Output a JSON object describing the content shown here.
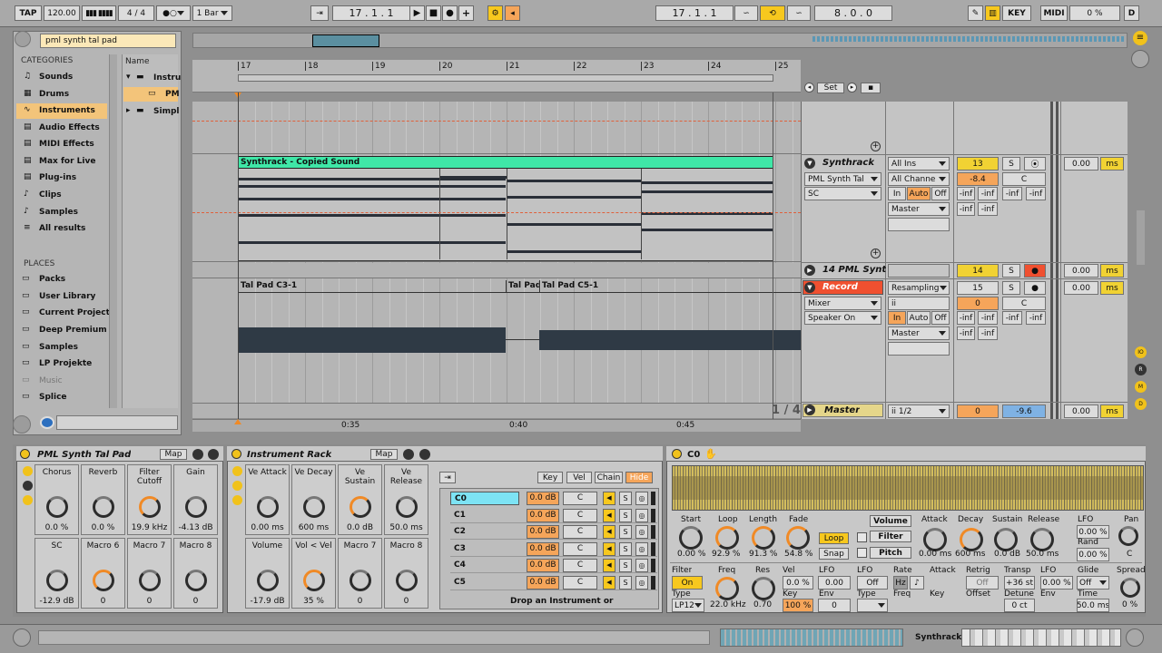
{
  "transport": {
    "tap": "TAP",
    "tempo": "120.00",
    "meter": "4 / 4",
    "quantize": "1 Bar",
    "position": "17 .  1 .  1",
    "loop_start": "17 .  1 .  1",
    "loop_length": "8 .  0 .  0",
    "key_label": "KEY",
    "midi_label": "MIDI",
    "cpu": "0 %",
    "d": "D"
  },
  "browser": {
    "search": "pml synth tal pad",
    "categories_title": "CATEGORIES",
    "categories": [
      "Sounds",
      "Drums",
      "Instruments",
      "Audio Effects",
      "MIDI Effects",
      "Max for Live",
      "Plug-ins",
      "Clips",
      "Samples",
      "All results"
    ],
    "places_title": "PLACES",
    "places": [
      "Packs",
      "User Library",
      "Current Project",
      "Deep Premium `",
      "Samples",
      "LP Projekte",
      "Music",
      "Splice"
    ],
    "name_header": "Name",
    "items": [
      "Instru",
      "PM",
      "Simpl"
    ]
  },
  "arrangement": {
    "bars": [
      "17",
      "18",
      "19",
      "20",
      "21",
      "22",
      "23",
      "24",
      "25"
    ],
    "times": [
      "0:35",
      "0:40",
      "0:45"
    ],
    "set_label": "Set",
    "zoom": "1 / 4"
  },
  "tracks": [
    {
      "name": "Synthrack",
      "clip": "Synthrack - Copied Sound",
      "device": "PML Synth Tal",
      "sub": "SC",
      "input": "All Ins",
      "channel": "All Channe",
      "mon_in": "In",
      "mon_auto": "Auto",
      "mon_off": "Off",
      "output": "Master",
      "number": "13",
      "vol": "-8.4",
      "pan": "C",
      "s": "S",
      "delay": "0.00",
      "ms": "ms",
      "inf": "-inf"
    },
    {
      "name": "14 PML Synt",
      "number": "14",
      "delay": "0.00",
      "ms": "ms"
    },
    {
      "name": "Record",
      "clips": [
        "Tal Pad C3-1",
        "Tal Pad",
        "Tal Pad C5-1"
      ],
      "device": "Mixer",
      "sub": "Speaker On",
      "input": "Resampling",
      "channel": "ii",
      "mon_in": "In",
      "mon_auto": "Auto",
      "mon_off": "Off",
      "output": "Master",
      "number": "15",
      "vol": "0",
      "pan": "C",
      "s": "S",
      "delay": "0.00",
      "ms": "ms",
      "inf": "-inf"
    },
    {
      "name": "Master",
      "io": "ii 1/2",
      "vol": "0",
      "pan": "-9.6",
      "delay": "0.00",
      "ms": "ms"
    }
  ],
  "device1": {
    "title": "PML Synth Tal Pad",
    "map": "Map",
    "macros": [
      {
        "name": "Chorus",
        "value": "0.0 %"
      },
      {
        "name": "Reverb",
        "value": "0.0 %"
      },
      {
        "name": "Filter Cutoff",
        "value": "19.9 kHz"
      },
      {
        "name": "Gain",
        "value": "-4.13 dB"
      },
      {
        "name": "SC",
        "value": "-12.9 dB"
      },
      {
        "name": "Macro 6",
        "value": "0"
      },
      {
        "name": "Macro 7",
        "value": "0"
      },
      {
        "name": "Macro 8",
        "value": "0"
      }
    ]
  },
  "device2": {
    "title": "Instrument Rack",
    "map": "Map",
    "macros": [
      {
        "name": "Ve Attack",
        "value": "0.00 ms"
      },
      {
        "name": "Ve Decay",
        "value": "600 ms"
      },
      {
        "name": "Ve Sustain",
        "value": "0.0 dB"
      },
      {
        "name": "Ve Release",
        "value": "50.0 ms"
      },
      {
        "name": "Volume",
        "value": "-17.9 dB"
      },
      {
        "name": "Vol < Vel",
        "value": "35 %"
      },
      {
        "name": "Macro 7",
        "value": "0"
      },
      {
        "name": "Macro 8",
        "value": "0"
      }
    ],
    "buttons": [
      "Key",
      "Vel",
      "Chain",
      "Hide"
    ],
    "chains": [
      {
        "name": "C0",
        "vol": "0.0 dB",
        "pan": "C"
      },
      {
        "name": "C1",
        "vol": "0.0 dB",
        "pan": "C"
      },
      {
        "name": "C2",
        "vol": "0.0 dB",
        "pan": "C"
      },
      {
        "name": "C3",
        "vol": "0.0 dB",
        "pan": "C"
      },
      {
        "name": "C4",
        "vol": "0.0 dB",
        "pan": "C"
      },
      {
        "name": "C5",
        "vol": "0.0 dB",
        "pan": "C"
      }
    ],
    "drop": "Drop an Instrument or"
  },
  "sampler": {
    "title": "C0",
    "start": {
      "label": "Start",
      "value": "0.00 %"
    },
    "loop": {
      "label": "Loop",
      "value": "92.9 %"
    },
    "length": {
      "label": "Length",
      "value": "91.3 %"
    },
    "fade": {
      "label": "Fade",
      "value": "54.8 %"
    },
    "loop_btn": "Loop",
    "snap_btn": "Snap",
    "volume_tab": "Volume",
    "filter_tab": "Filter",
    "pitch_tab": "Pitch",
    "attack": {
      "label": "Attack",
      "value": "0.00 ms"
    },
    "decay": {
      "label": "Decay",
      "value": "600 ms"
    },
    "sustain": {
      "label": "Sustain",
      "value": "0.0 dB"
    },
    "release": {
      "label": "Release",
      "value": "50.0 ms"
    },
    "lfo_label": "LFO",
    "lfo_value": "0.00 %",
    "rand_label": "Rand",
    "rand_value": "0.00 %",
    "pan_label": "Pan",
    "pan_value": "C",
    "filter_label": "Filter",
    "filter_on": "On",
    "type_label": "Type",
    "type_value": "LP12",
    "freq_label": "Freq",
    "freq_value": "22.0 kHz",
    "res_label": "Res",
    "res_value": "0.70",
    "vel_label": "Vel",
    "vel_value": "0.0 %",
    "key_label": "Key",
    "key_value": "100 %",
    "lfo2_label": "LFO",
    "lfo2_value": "0.00",
    "env_label": "Env",
    "env_value": "0",
    "lfo3_label": "LFO",
    "lfo3_value": "Off",
    "type2_label": "Type",
    "rate_label": "Rate",
    "rate_hz": "Hz",
    "attack2_label": "Attack",
    "retrig_label": "Retrig",
    "retrig_value": "Off",
    "freq2_label": "Freq",
    "key2_label": "Key",
    "offset_label": "Offset",
    "transp_label": "Transp",
    "transp_value": "+36 st",
    "lfo4_label": "LFO",
    "lfo4_value": "0.00 %",
    "glide_label": "Glide",
    "glide_value": "Off",
    "spread_label": "Spread",
    "spread_value": "0 %",
    "detune_label": "Detune",
    "detune_value": "0 ct",
    "env2_label": "Env",
    "time_label": "Time",
    "time_value": "50.0 ms"
  },
  "statusbar": {
    "track": "Synthrack"
  }
}
